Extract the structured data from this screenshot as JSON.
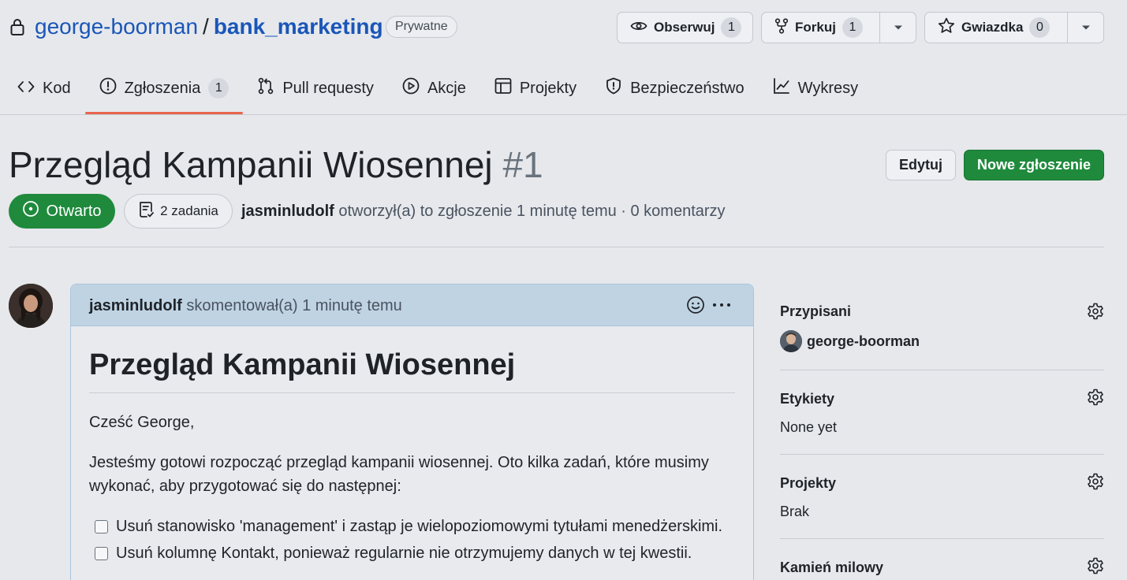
{
  "repo": {
    "owner": "george-boorman",
    "separator": "/",
    "name": "bank_marketing",
    "visibility": "Prywatne"
  },
  "actions": {
    "watch": {
      "label": "Obserwuj",
      "count": "1",
      "icon": "eye-icon"
    },
    "fork": {
      "label": "Forkuj",
      "count": "1",
      "icon": "repo-forked-icon"
    },
    "star": {
      "label": "Gwiazdka",
      "count": "0",
      "icon": "star-icon"
    }
  },
  "nav": {
    "items": [
      {
        "label": "Kod",
        "icon": "code-icon"
      },
      {
        "label": "Zgłoszenia",
        "count": "1",
        "icon": "issue-opened-icon",
        "active": true
      },
      {
        "label": "Pull requesty",
        "icon": "git-pull-request-icon"
      },
      {
        "label": "Akcje",
        "icon": "play-icon"
      },
      {
        "label": "Projekty",
        "icon": "table-icon"
      },
      {
        "label": "Bezpieczeństwo",
        "icon": "shield-icon"
      },
      {
        "label": "Wykresy",
        "icon": "graph-icon"
      }
    ]
  },
  "issue": {
    "title": "Przegląd Kampanii Wiosennej",
    "number": "#1",
    "edit_label": "Edytuj",
    "new_issue_label": "Nowe zgłoszenie",
    "state": "Otwarto",
    "tasks": "2 zadania",
    "author": "jasminludolf",
    "meta_text": "otworzył(a) to zgłoszenie 1 minutę temu · 0 komentarzy"
  },
  "comment": {
    "author": "jasminludolf",
    "action": "skomentował(a) 1 minutę temu",
    "heading": "Przegląd Kampanii Wiosennej",
    "greeting": "Cześć George,",
    "intro": "Jesteśmy gotowi rozpocząć przegląd kampanii wiosennej. Oto kilka zadań, które musimy wykonać, aby przygotować się do następnej:",
    "tasks": [
      {
        "text": "Usuń stanowisko 'management' i zastąp je wielopoziomowymi tytułami menedżerskimi.",
        "checked": false
      },
      {
        "text": "Usuń kolumnę Kontakt, ponieważ regularnie nie otrzymujemy danych w tej kwestii.",
        "checked": false
      }
    ]
  },
  "sidebar": {
    "assignees": {
      "heading": "Przypisani",
      "user": "george-boorman"
    },
    "labels": {
      "heading": "Etykiety",
      "value": "None yet"
    },
    "projects": {
      "heading": "Projekty",
      "value": "Brak"
    },
    "milestone": {
      "heading": "Kamień milowy"
    }
  },
  "colors": {
    "link": "#1a56b8",
    "primary_green": "#1f8a3c",
    "active_tab_underline": "#e8654c",
    "comment_header": "#bfd3e3"
  }
}
